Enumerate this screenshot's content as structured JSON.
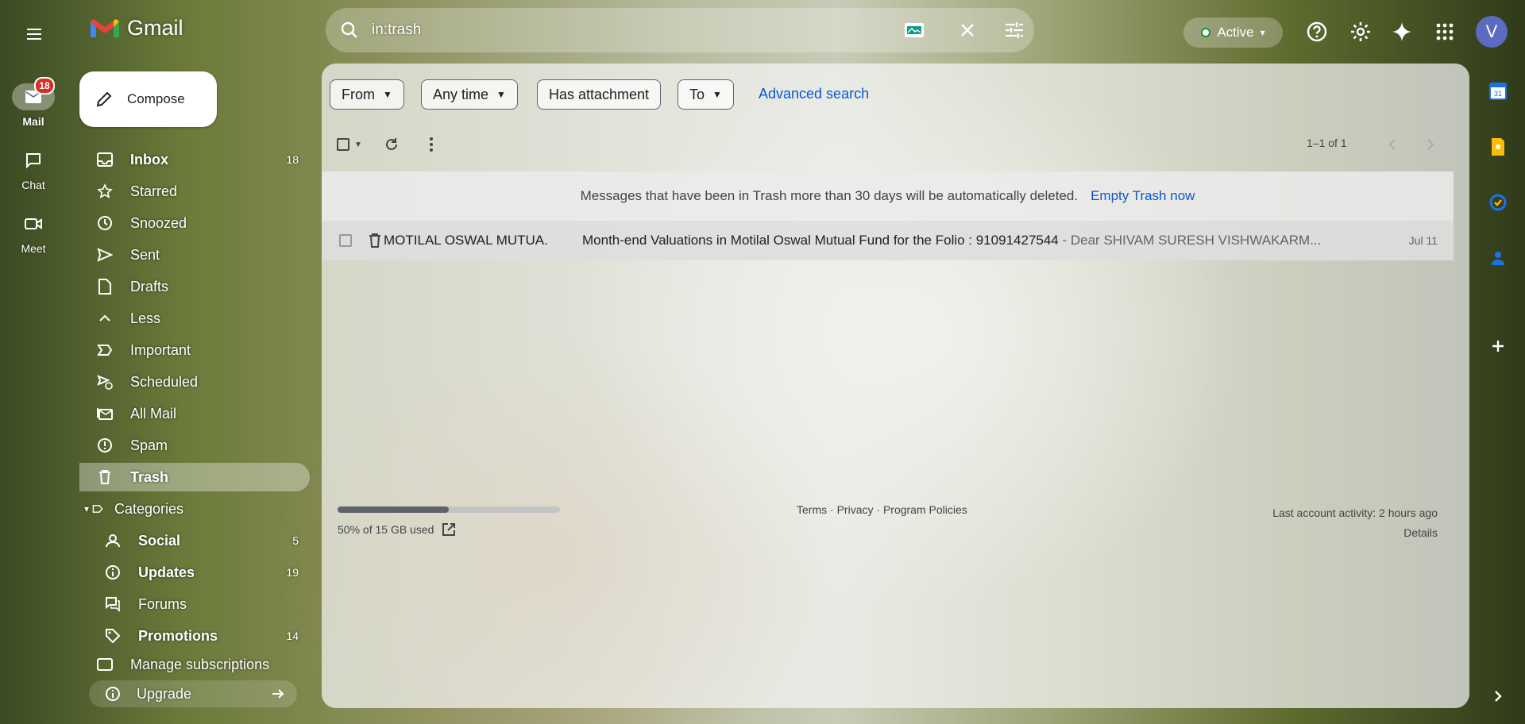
{
  "rail": {
    "items": [
      {
        "label": "Mail",
        "badge": "18"
      },
      {
        "label": "Chat"
      },
      {
        "label": "Meet"
      }
    ]
  },
  "app": {
    "name": "Gmail"
  },
  "compose": {
    "label": "Compose"
  },
  "nav": {
    "items": [
      {
        "label": "Inbox",
        "count": "18"
      },
      {
        "label": "Starred"
      },
      {
        "label": "Snoozed"
      },
      {
        "label": "Sent"
      },
      {
        "label": "Drafts"
      },
      {
        "label": "Less"
      },
      {
        "label": "Important"
      },
      {
        "label": "Scheduled"
      },
      {
        "label": "All Mail"
      },
      {
        "label": "Spam"
      },
      {
        "label": "Trash"
      },
      {
        "label": "Categories"
      },
      {
        "label": "Social",
        "count": "5"
      },
      {
        "label": "Updates",
        "count": "19"
      },
      {
        "label": "Forums"
      },
      {
        "label": "Promotions",
        "count": "14"
      },
      {
        "label": "Manage subscriptions"
      }
    ],
    "upgrade": "Upgrade"
  },
  "search": {
    "value": "in:trash"
  },
  "header": {
    "status": "Active",
    "avatar_letter": "V"
  },
  "filters": {
    "from": "From",
    "any_time": "Any time",
    "has_attachment": "Has attachment",
    "to": "To",
    "advanced": "Advanced search"
  },
  "pager": {
    "range": "1–1 of 1"
  },
  "notice": {
    "text": "Messages that have been in Trash more than 30 days will be automatically deleted.",
    "action": "Empty Trash now"
  },
  "messages": [
    {
      "sender": "MOTILAL OSWAL MUTUA.",
      "subject": "Month-end Valuations in Motilal Oswal Mutual Fund for the Folio : 91091427544",
      "snippet": " - Dear SHIVAM SURESH VISHWAKARM...",
      "date": "Jul 11"
    }
  ],
  "footer": {
    "storage": "50% of 15 GB used",
    "storage_fraction": 0.5,
    "terms": "Terms",
    "privacy": "Privacy",
    "policies": "Program Policies",
    "activity": "Last account activity: 2 hours ago",
    "details": "Details"
  },
  "colors": {
    "accent": "#0b57d0",
    "badge": "#d93025",
    "active_dot": "#1e8e3e"
  }
}
